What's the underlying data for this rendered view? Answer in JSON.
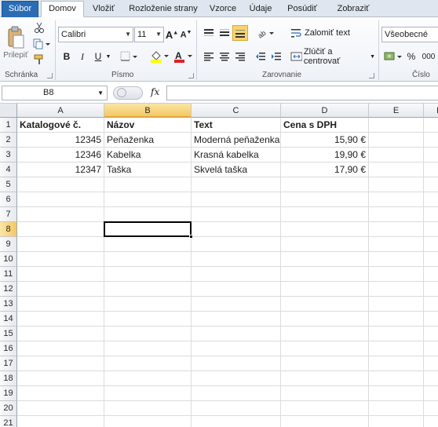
{
  "tabs": {
    "file": "Súbor",
    "home": "Domov",
    "insert": "Vložiť",
    "page_layout": "Rozloženie strany",
    "formulas": "Vzorce",
    "data": "Údaje",
    "review": "Posúdiť",
    "view": "Zobraziť"
  },
  "ribbon": {
    "clipboard": {
      "paste_label": "Prilepiť",
      "group_label": "Schránka"
    },
    "font": {
      "font_name": "Calibri",
      "font_size": "11",
      "group_label": "Písmo",
      "bold": "B",
      "italic": "I",
      "underline": "U"
    },
    "alignment": {
      "wrap_text": "Zalomiť text",
      "merge_center": "Zlúčiť a centrovať",
      "group_label": "Zarovnanie"
    },
    "number": {
      "format": "Všeobecné",
      "percent": "%",
      "thousands": "000",
      "group_label": "Číslo"
    }
  },
  "formula_bar": {
    "name_box": "B8",
    "fx": "fx",
    "formula": ""
  },
  "columns": [
    "A",
    "B",
    "C",
    "D",
    "E",
    "F"
  ],
  "rows": [
    "1",
    "2",
    "3",
    "4",
    "5",
    "6",
    "7",
    "8",
    "9",
    "10",
    "11",
    "12",
    "13",
    "14",
    "15",
    "16",
    "17",
    "18",
    "19",
    "20",
    "21"
  ],
  "cells": {
    "A1": "Katalogové č.",
    "B1": "Názov",
    "C1": "Text",
    "D1": "Cena s DPH",
    "A2": "12345",
    "B2": "Peňaženka",
    "C2": "Moderná peňaženka",
    "D2": "15,90 €",
    "A3": "12346",
    "B3": "Kabelka",
    "C3": "Krasná kabelka",
    "D3": "19,90 €",
    "A4": "12347",
    "B4": "Taška",
    "C4": "Skvelá taška",
    "D4": "17,90 €"
  },
  "selected_cell": "B8",
  "colors": {
    "file_tab": "#2a6db5",
    "selection_header": "#f4c862",
    "grid_line": "#dadcdd"
  }
}
